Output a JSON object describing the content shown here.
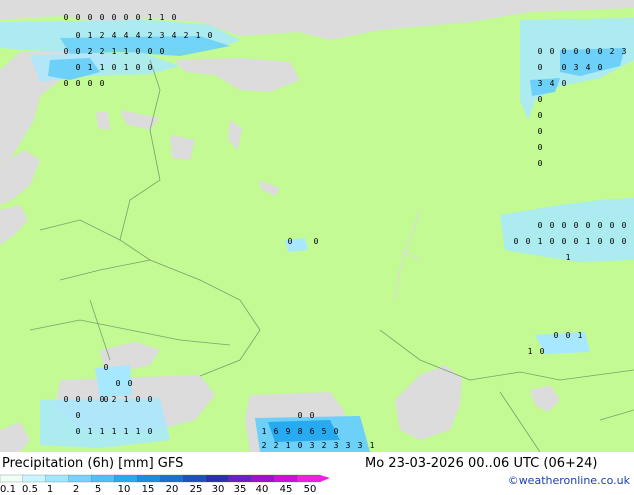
{
  "map": {
    "colors": {
      "land": "#c3fa94",
      "sea": "#dcdcdc",
      "border": "#7aa06a"
    },
    "precip_values": [
      "0",
      "0",
      "0",
      "0",
      "0",
      "0",
      "0",
      "1",
      "1",
      "0",
      "0",
      "1",
      "2",
      "4",
      "4",
      "4",
      "2",
      "3",
      "4",
      "2",
      "1",
      "0",
      "0",
      "0",
      "2",
      "2",
      "1",
      "1",
      "0",
      "0",
      "0",
      "0",
      "1",
      "1",
      "0",
      "1",
      "0",
      "0",
      "0",
      "0",
      "0",
      "0",
      "0",
      "0",
      "0",
      "0",
      "0",
      "0",
      "2",
      "3",
      "0",
      "0",
      "3",
      "4",
      "0",
      "3",
      "4",
      "0",
      "0",
      "0",
      "0",
      "0",
      "0",
      "0",
      "0",
      "0",
      "0",
      "0",
      "0",
      "0",
      "0",
      "0",
      "0",
      "1",
      "0",
      "0",
      "0",
      "1",
      "0",
      "0",
      "0",
      "1",
      "0",
      "0",
      "0",
      "0",
      "1",
      "1",
      "0",
      "0",
      "0",
      "0",
      "0",
      "0",
      "0",
      "0",
      "0",
      "2",
      "1",
      "0",
      "0",
      "0",
      "0",
      "1",
      "1",
      "1",
      "1",
      "1",
      "0",
      "1",
      "6",
      "9",
      "8",
      "6",
      "5",
      "0",
      "2",
      "2",
      "1",
      "0",
      "3",
      "2",
      "3",
      "3",
      "3",
      "1",
      "0",
      "0"
    ]
  },
  "footer": {
    "title": "Precipitation (6h) [mm]",
    "model": "GFS",
    "datetime": "Mo 23-03-2026 00..06 UTC (06+24)",
    "credit": "©weatheronline.co.uk",
    "scale_labels": [
      "0.1",
      "0.5",
      "1",
      "2",
      "5",
      "10",
      "15",
      "20",
      "25",
      "30",
      "35",
      "40",
      "45",
      "50"
    ],
    "scale_colors": [
      "#f0fff5",
      "#c8f5ff",
      "#a0e6ff",
      "#78d2ff",
      "#50c0f8",
      "#28aaf0",
      "#1a8ee0",
      "#1a70d0",
      "#1e50c0",
      "#2a30b0",
      "#6a20c8",
      "#a010d0",
      "#d010d8",
      "#f020e0"
    ]
  }
}
